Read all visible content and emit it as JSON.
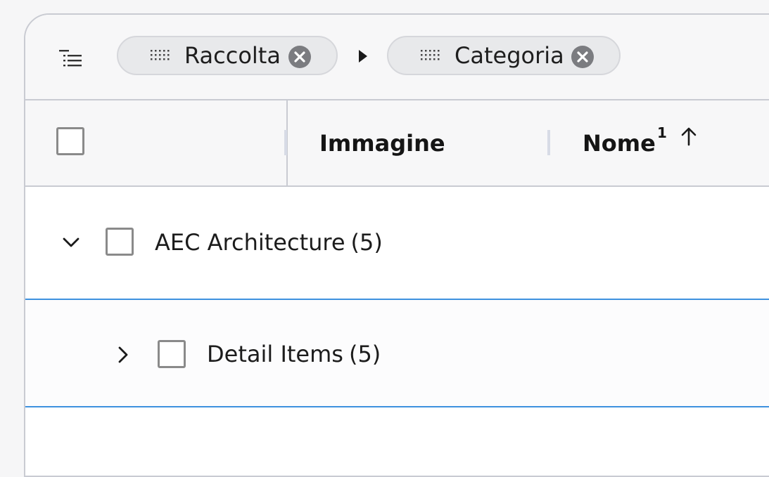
{
  "group_bar": {
    "icon": "group-list-icon",
    "chips": [
      {
        "label": "Raccolta",
        "grip_icon": "drag-grip-icon",
        "close_icon": "close-circle-icon"
      },
      {
        "label": "Categoria",
        "grip_icon": "drag-grip-icon",
        "close_icon": "close-circle-icon"
      }
    ],
    "separator_icon": "caret-right-icon"
  },
  "header": {
    "columns": [
      {
        "label": "Immagine"
      },
      {
        "label": "Nome",
        "sort_index": "1",
        "sort_direction": "ascending",
        "sort_icon": "arrow-up-icon"
      }
    ]
  },
  "rows": [
    {
      "label": "AEC Architecture",
      "count": "(5)",
      "expanded": true,
      "level": 0
    },
    {
      "label": "Detail Items",
      "count": "(5)",
      "expanded": false,
      "level": 1,
      "focused": true
    }
  ],
  "colors": {
    "focus_border": "#3d91df",
    "chip_background": "#e8e9eb",
    "chip_close": "#7b7c80",
    "header_background": "#f7f7f8",
    "border": "#c9cbd2"
  }
}
